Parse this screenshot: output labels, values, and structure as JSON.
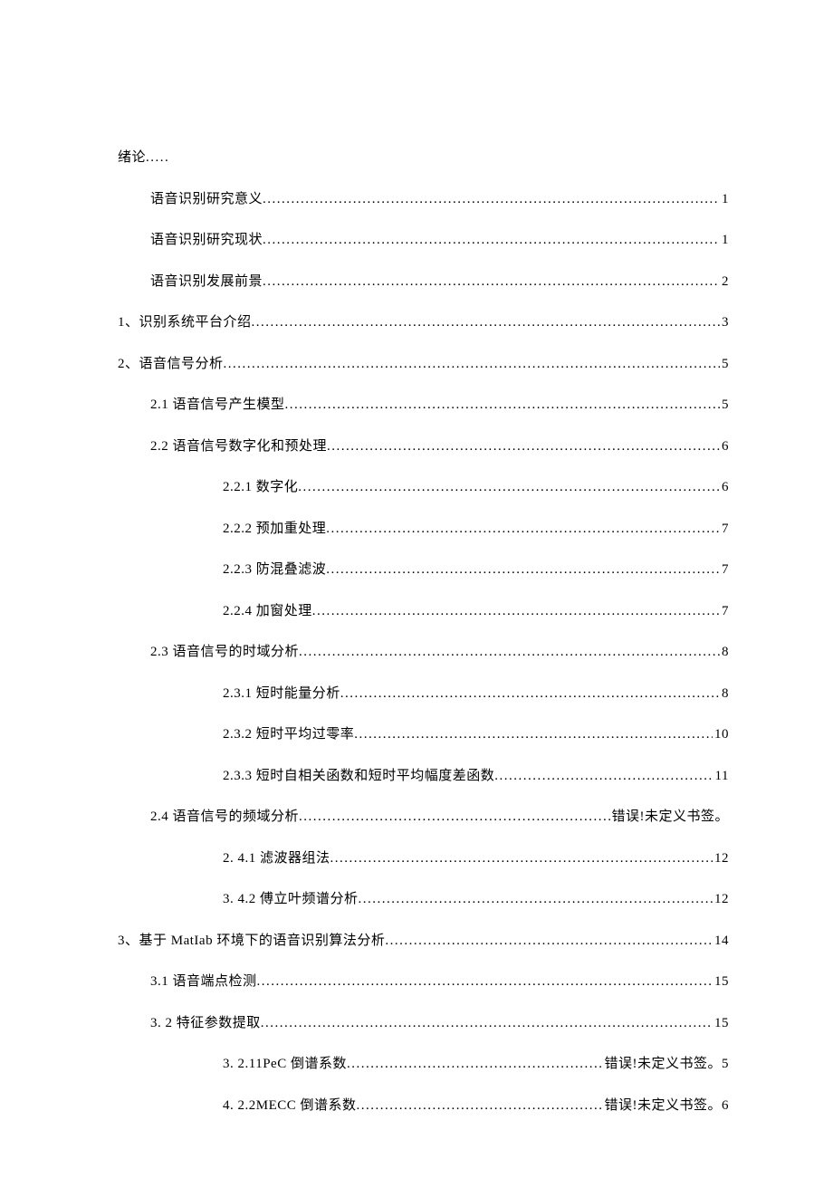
{
  "toc": [
    {
      "indent": 0,
      "label": "绪论",
      "page": "",
      "style": "no-dots no-page"
    },
    {
      "indent": 1,
      "label": "语音识别研究意义",
      "page": "1"
    },
    {
      "indent": 1,
      "label": "语音识别研究现状",
      "page": "1"
    },
    {
      "indent": 1,
      "label": "语音识别发展前景",
      "page": "2"
    },
    {
      "indent": 0,
      "label": "1、识别系统平台介绍",
      "page": "3"
    },
    {
      "indent": 0,
      "label": "2、语音信号分析",
      "page": "5"
    },
    {
      "indent": 1,
      "label": "2.1 语音信号产生模型",
      "page": "5"
    },
    {
      "indent": 1,
      "label": "2.2 语音信号数字化和预处理",
      "page": "6"
    },
    {
      "indent": 2,
      "label": "2.2.1 数字化",
      "page": "6"
    },
    {
      "indent": 2,
      "label": "2.2.2 预加重处理",
      "page": "7"
    },
    {
      "indent": 2,
      "label": "2.2.3 防混叠滤波",
      "page": "7"
    },
    {
      "indent": 2,
      "label": "2.2.4 加窗处理",
      "page": "7"
    },
    {
      "indent": 1,
      "label": "2.3 语音信号的时域分析",
      "page": "8"
    },
    {
      "indent": 2,
      "label": "2.3.1 短时能量分析",
      "page": "8"
    },
    {
      "indent": 2,
      "label": "2.3.2 短时平均过零率",
      "page": "10"
    },
    {
      "indent": 2,
      "label": "2.3.3 短时自相关函数和短时平均幅度差函数",
      "page": "11"
    },
    {
      "indent": 1,
      "label": "2.4 语音信号的频域分析",
      "page": "错误!未定义书签。"
    },
    {
      "indent": 2,
      "label": "2.  4.1 滤波器组法",
      "page": "12"
    },
    {
      "indent": 2,
      "label": "3.  4.2 傅立叶频谱分析",
      "page": "12"
    },
    {
      "indent": 0,
      "label": "3、基于 MatIab 环境下的语音识别算法分析 ",
      "page": "14"
    },
    {
      "indent": 1,
      "label": "3.1 语音端点检测",
      "page": "15"
    },
    {
      "indent": 1,
      "label": "3.  2 特征参数提取",
      "page": "15"
    },
    {
      "indent": 2,
      "label": "3.  2.11PeC 倒谱系数 ",
      "page": "错误!未定义书签。5"
    },
    {
      "indent": 2,
      "label": "4.  2.2MECC 倒谱系数 ",
      "page": "错误!未定义书签。6"
    }
  ]
}
